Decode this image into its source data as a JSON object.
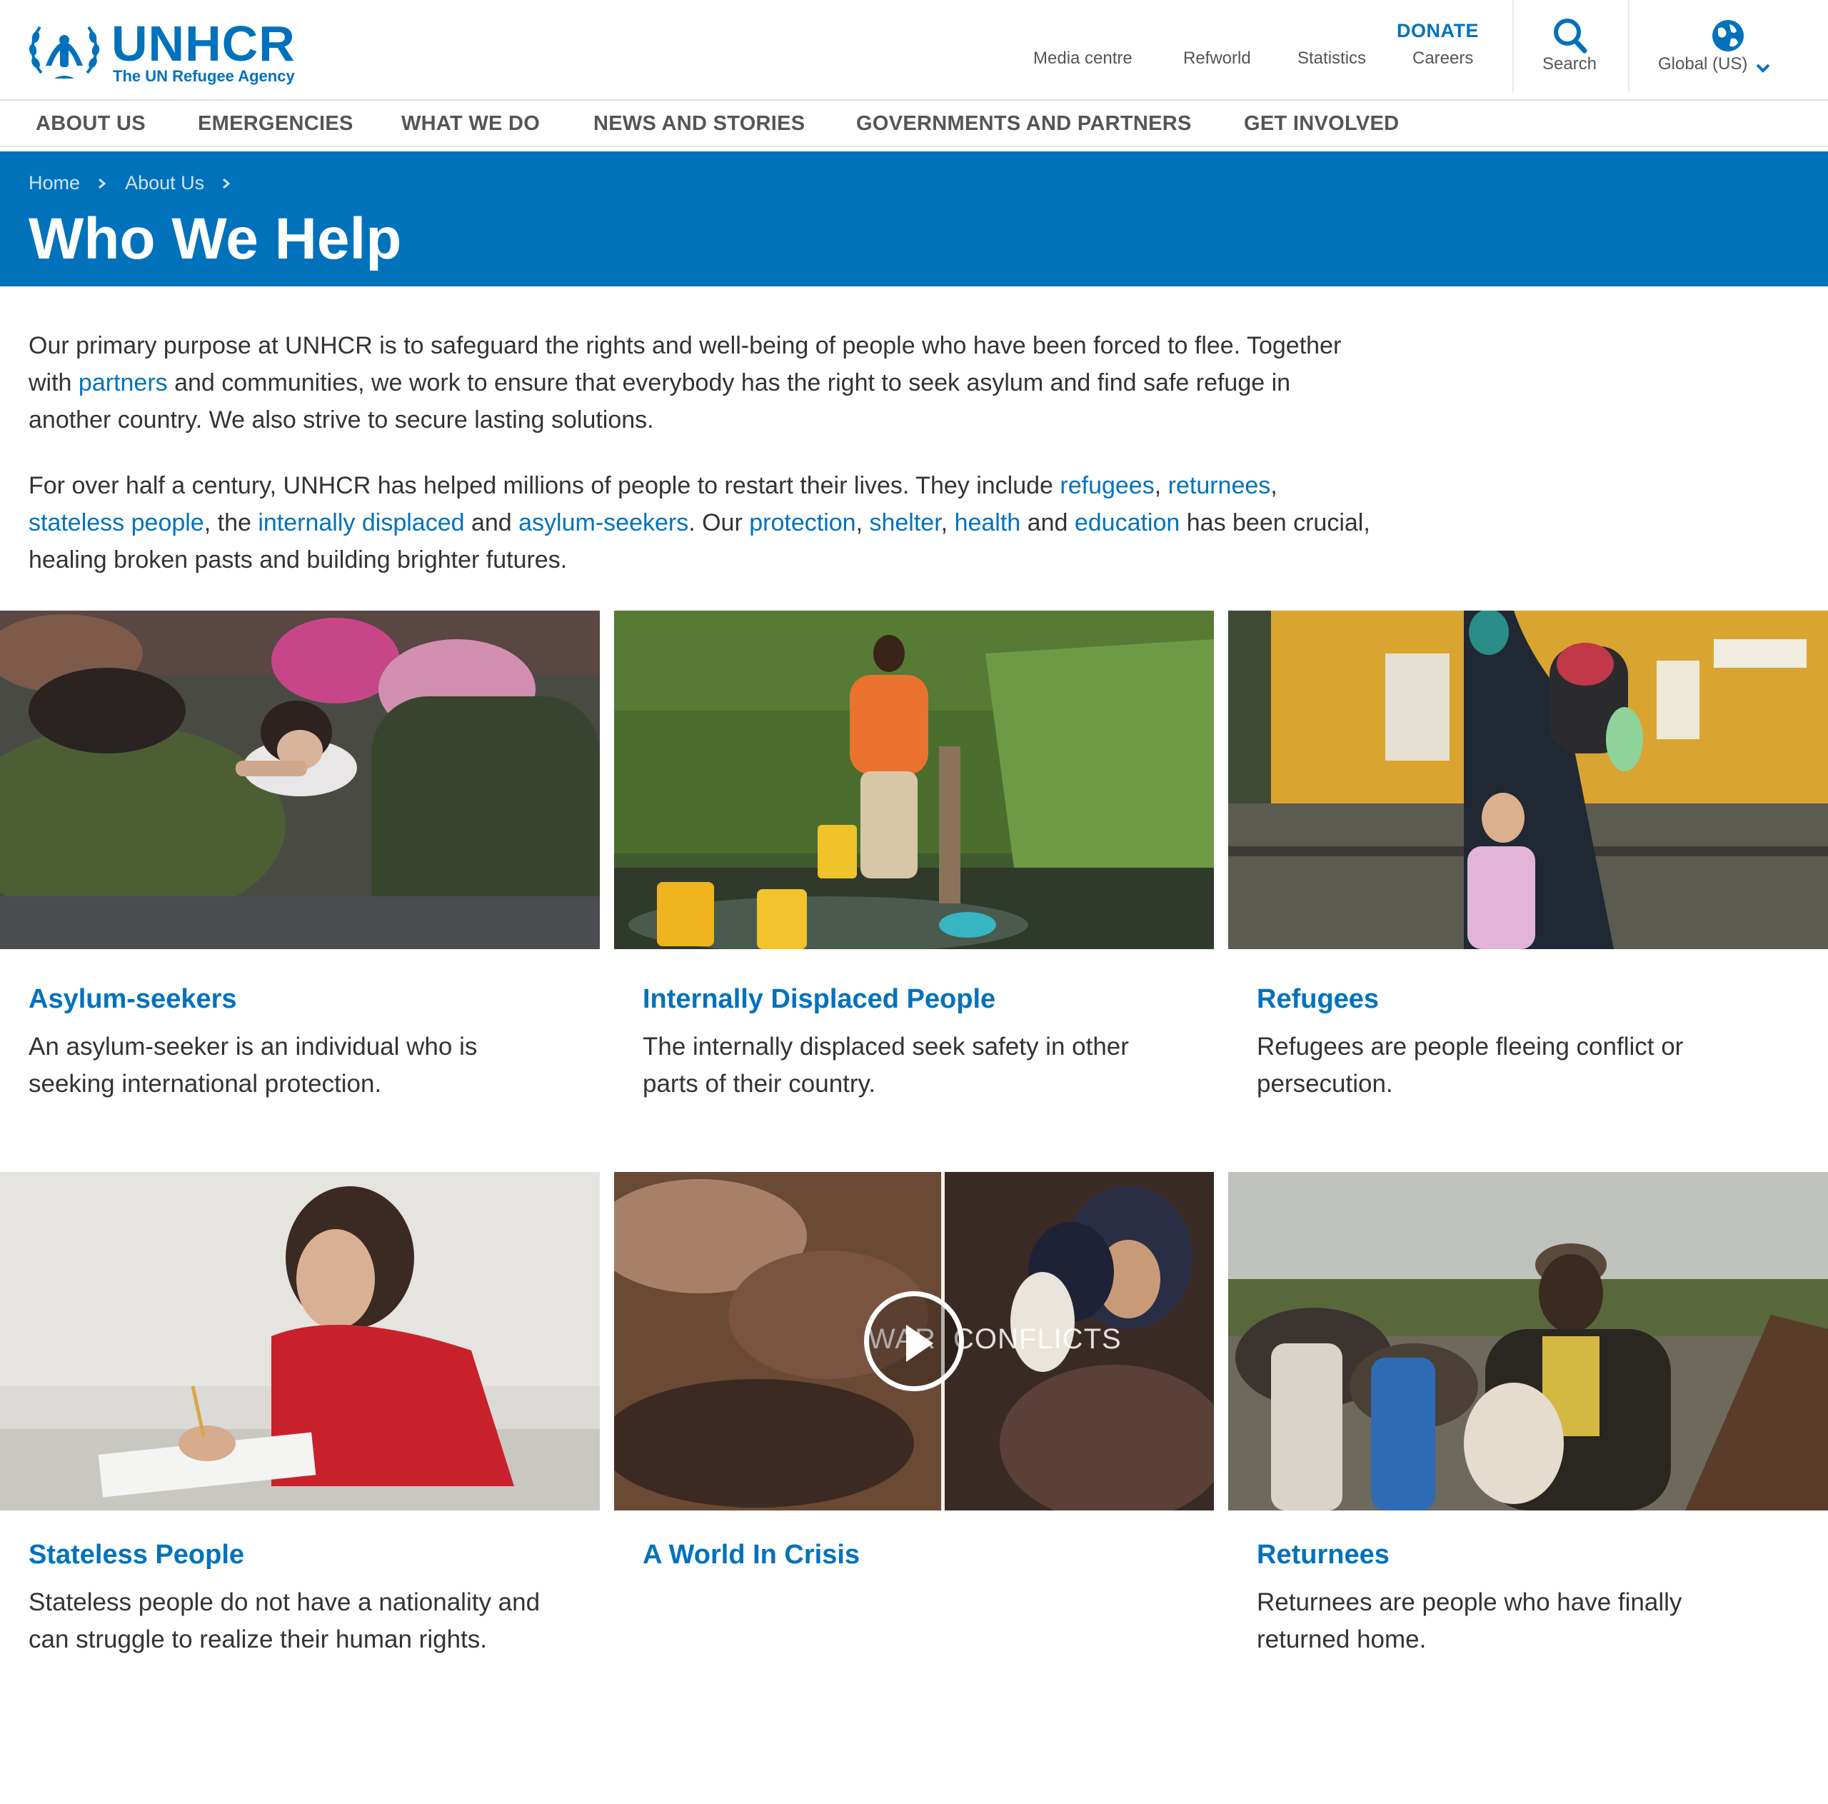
{
  "brand": {
    "name": "UNHCR",
    "tagline": "The UN Refugee Agency",
    "color": "#0072bc"
  },
  "utility_nav": {
    "donate": "DONATE",
    "links": [
      "Media centre",
      "Refworld",
      "Statistics",
      "Careers"
    ],
    "search_label": "Search",
    "region_label": "Global (US)"
  },
  "main_nav": [
    "ABOUT US",
    "EMERGENCIES",
    "WHAT WE DO",
    "NEWS AND STORIES",
    "GOVERNMENTS AND PARTNERS",
    "GET INVOLVED"
  ],
  "breadcrumb": [
    "Home",
    "About Us"
  ],
  "page_title": "Who We Help",
  "intro": {
    "p1": {
      "a": "Our primary purpose at UNHCR is to safeguard the rights and well-being of people who have been forced to flee. Together with ",
      "link_partners": "partners",
      "b": " and communities, we work to ensure that everybody has the right to seek asylum and find safe refuge in another country. We also strive to secure lasting solutions."
    },
    "p2": {
      "a": "For over half a century, UNHCR has helped millions of people to restart their lives. They include ",
      "link_refugees": "refugees",
      "s1": ", ",
      "link_returnees": "returnees",
      "s2": ", ",
      "link_stateless": "stateless people",
      "s3": ", the ",
      "link_idp": "internally displaced",
      "s4": " and ",
      "link_asylum": "asylum-seekers",
      "s5": ". Our ",
      "link_protection": "protection",
      "s6": ", ",
      "link_shelter": "shelter",
      "s7": ", ",
      "link_health": "health",
      "s8": " and ",
      "link_education": "education",
      "b": " has been crucial, healing broken pasts and building brighter futures."
    }
  },
  "cards": [
    {
      "title": "Asylum-seekers",
      "description": "An asylum-seeker is an individual who is seeking international protection."
    },
    {
      "title": "Internally Displaced People",
      "description": "The internally displaced seek safety in other parts of their country."
    },
    {
      "title": "Refugees",
      "description": "Refugees are people fleeing conflict or persecution."
    },
    {
      "title": "Stateless People",
      "description": "Stateless people do not have a nationality and can struggle to realize their human rights."
    },
    {
      "title": "A World In Crisis",
      "description": "",
      "video_words": [
        "WAR",
        "CONFLICTS"
      ]
    },
    {
      "title": "Returnees",
      "description": "Returnees are people who have finally returned home."
    }
  ]
}
